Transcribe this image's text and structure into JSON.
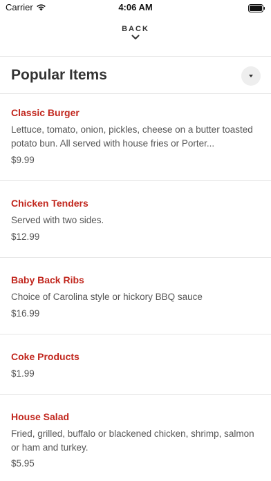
{
  "status_bar": {
    "carrier": "Carrier",
    "time": "4:06 AM"
  },
  "nav": {
    "back_label": "BACK"
  },
  "section": {
    "title": "Popular Items"
  },
  "items": [
    {
      "name": "Classic Burger",
      "description": "Lettuce, tomato, onion, pickles, cheese on a butter toasted potato bun. All served with house fries or Porter...",
      "price": "$9.99"
    },
    {
      "name": "Chicken Tenders",
      "description": "Served with two sides.",
      "price": "$12.99"
    },
    {
      "name": "Baby Back Ribs",
      "description": "Choice of Carolina style or hickory BBQ sauce",
      "price": "$16.99"
    },
    {
      "name": "Coke Products",
      "description": "",
      "price": "$1.99"
    },
    {
      "name": "House Salad",
      "description": "Fried, grilled, buffalo or blackened chicken, shrimp, salmon or ham and turkey.",
      "price": "$5.95"
    }
  ],
  "colors": {
    "item_name": "#c1261d",
    "text_secondary": "#555555",
    "divider": "#e6e6e6"
  }
}
